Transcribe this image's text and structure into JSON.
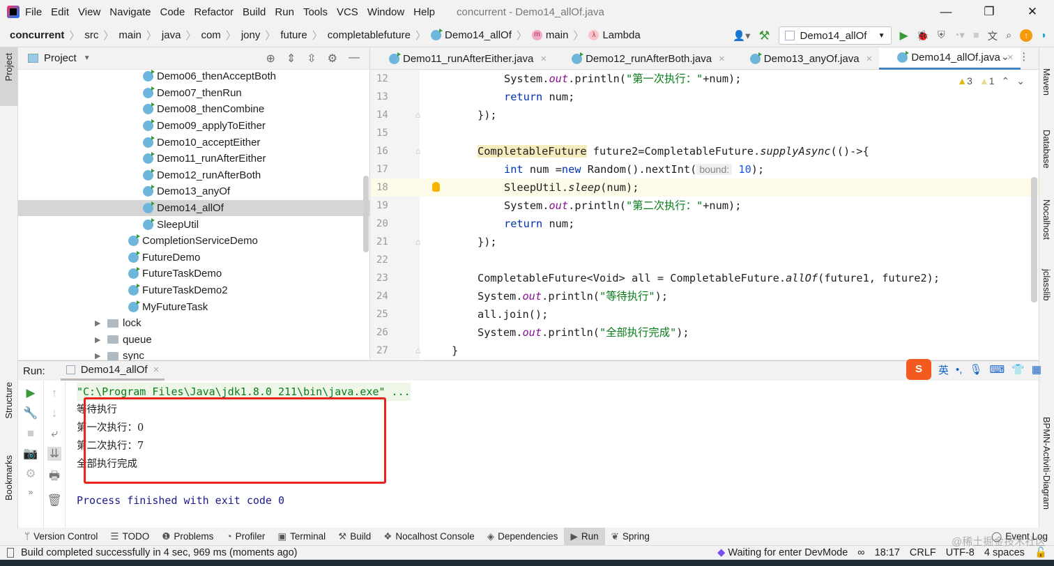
{
  "menu": [
    "File",
    "Edit",
    "View",
    "Navigate",
    "Code",
    "Refactor",
    "Build",
    "Run",
    "Tools",
    "VCS",
    "Window",
    "Help"
  ],
  "window_title": "concurrent - Demo14_allOf.java",
  "breadcrumbs": [
    "concurrent",
    "src",
    "main",
    "java",
    "com",
    "jony",
    "future",
    "completablefuture",
    "Demo14_allOf",
    "main",
    "Lambda"
  ],
  "run_config": "Demo14_allOf",
  "project_panel": {
    "title": "Project",
    "items": [
      {
        "label": "Demo06_thenAcceptBoth",
        "type": "class",
        "depth": 3
      },
      {
        "label": "Demo07_thenRun",
        "type": "class",
        "depth": 3
      },
      {
        "label": "Demo08_thenCombine",
        "type": "class",
        "depth": 3
      },
      {
        "label": "Demo09_applyToEither",
        "type": "class",
        "depth": 3
      },
      {
        "label": "Demo10_acceptEither",
        "type": "class",
        "depth": 3
      },
      {
        "label": "Demo11_runAfterEither",
        "type": "class",
        "depth": 3
      },
      {
        "label": "Demo12_runAfterBoth",
        "type": "class",
        "depth": 3
      },
      {
        "label": "Demo13_anyOf",
        "type": "class",
        "depth": 3
      },
      {
        "label": "Demo14_allOf",
        "type": "class",
        "depth": 3,
        "selected": true
      },
      {
        "label": "SleepUtil",
        "type": "class",
        "depth": 3
      },
      {
        "label": "CompletionServiceDemo",
        "type": "class",
        "depth": 2
      },
      {
        "label": "FutureDemo",
        "type": "class",
        "depth": 2
      },
      {
        "label": "FutureTaskDemo",
        "type": "class",
        "depth": 2
      },
      {
        "label": "FutureTaskDemo2",
        "type": "class",
        "depth": 2
      },
      {
        "label": "MyFutureTask",
        "type": "class",
        "depth": 2
      },
      {
        "label": "lock",
        "type": "folder",
        "depth": 1
      },
      {
        "label": "queue",
        "type": "folder",
        "depth": 1
      },
      {
        "label": "sync",
        "type": "folder",
        "depth": 1
      }
    ]
  },
  "editor_tabs": [
    {
      "label": "Demo11_runAfterEither.java"
    },
    {
      "label": "Demo12_runAfterBoth.java"
    },
    {
      "label": "Demo13_anyOf.java"
    },
    {
      "label": "Demo14_allOf.java",
      "active": true
    }
  ],
  "inspections": {
    "warnings": "3",
    "weak_warnings": "1"
  },
  "code": [
    {
      "n": "12",
      "indent": 2,
      "seg": [
        [
          "System.",
          ""
        ],
        [
          "out",
          "f"
        ],
        [
          ".println(",
          ""
        ],
        [
          "\"第一次执行：\"",
          "s"
        ],
        [
          "+num);",
          ""
        ]
      ]
    },
    {
      "n": "13",
      "indent": 2,
      "seg": [
        [
          "return",
          "k"
        ],
        [
          " num;",
          ""
        ]
      ]
    },
    {
      "n": "14",
      "indent": 1,
      "seg": [
        [
          "});",
          ""
        ]
      ]
    },
    {
      "n": "15",
      "indent": 0,
      "seg": []
    },
    {
      "n": "16",
      "indent": 1,
      "seg": [
        [
          "CompletableFuture",
          "hl"
        ],
        [
          " future2=CompletableFuture.",
          ""
        ],
        [
          "supplyAsync",
          "i"
        ],
        [
          "(()->{",
          ""
        ]
      ]
    },
    {
      "n": "17",
      "indent": 2,
      "seg": [
        [
          "int",
          "k"
        ],
        [
          " num =",
          ""
        ],
        [
          "new",
          "k"
        ],
        [
          " Random().nextInt(",
          ""
        ],
        [
          "bound:",
          "hint"
        ],
        [
          " ",
          ""
        ],
        [
          "10",
          "n"
        ],
        [
          ");",
          ""
        ]
      ]
    },
    {
      "n": "18",
      "indent": 2,
      "current": true,
      "seg": [
        [
          "SleepUtil",
          ""
        ],
        [
          ".",
          ""
        ],
        [
          "sleep",
          "i"
        ],
        [
          "(num);",
          ""
        ]
      ]
    },
    {
      "n": "19",
      "indent": 2,
      "seg": [
        [
          "System.",
          ""
        ],
        [
          "out",
          "f"
        ],
        [
          ".println(",
          ""
        ],
        [
          "\"第二次执行：\"",
          "s"
        ],
        [
          "+num);",
          ""
        ]
      ]
    },
    {
      "n": "20",
      "indent": 2,
      "seg": [
        [
          "return",
          "k"
        ],
        [
          " num;",
          ""
        ]
      ]
    },
    {
      "n": "21",
      "indent": 1,
      "seg": [
        [
          "});",
          ""
        ]
      ]
    },
    {
      "n": "22",
      "indent": 0,
      "seg": []
    },
    {
      "n": "23",
      "indent": 1,
      "seg": [
        [
          "CompletableFuture<Void> all = CompletableFuture.",
          ""
        ],
        [
          "allOf",
          "i"
        ],
        [
          "(future1, future2);",
          ""
        ]
      ]
    },
    {
      "n": "24",
      "indent": 1,
      "seg": [
        [
          "System.",
          ""
        ],
        [
          "out",
          "f"
        ],
        [
          ".println(",
          ""
        ],
        [
          "\"等待执行\"",
          "s"
        ],
        [
          ");",
          ""
        ]
      ]
    },
    {
      "n": "25",
      "indent": 1,
      "seg": [
        [
          "all.join();",
          ""
        ]
      ]
    },
    {
      "n": "26",
      "indent": 1,
      "seg": [
        [
          "System.",
          ""
        ],
        [
          "out",
          "f"
        ],
        [
          ".println(",
          ""
        ],
        [
          "\"全部执行完成\"",
          "s"
        ],
        [
          ");",
          ""
        ]
      ]
    },
    {
      "n": "27",
      "indent": 0,
      "seg": [
        [
          "}",
          ""
        ]
      ]
    }
  ],
  "run_panel": {
    "label": "Run:",
    "tab": "Demo14_allOf",
    "command": "\"C:\\Program Files\\Java\\jdk1.8.0_211\\bin\\java.exe\" ...",
    "output": [
      "等待执行",
      "第一次执行：0",
      "第二次执行：7",
      "全部执行完成"
    ],
    "exit": "Process finished with exit code 0"
  },
  "ime": {
    "lang": "英",
    "logo": "S"
  },
  "left_stripe": [
    "Project",
    "Structure",
    "Bookmarks"
  ],
  "right_stripe": [
    "Maven",
    "Database",
    "Nocalhost",
    "jclasslib",
    "BPMN-Activiti-Diagram"
  ],
  "tool_windows": [
    "Version Control",
    "TODO",
    "Problems",
    "Profiler",
    "Terminal",
    "Build",
    "Nocalhost Console",
    "Dependencies",
    "Run",
    "Spring",
    "Event Log"
  ],
  "status": {
    "message": "Build completed successfully in 4 sec, 969 ms (moments ago)",
    "devmode": "Waiting for enter DevMode",
    "position": "18:17",
    "line_sep": "CRLF",
    "encoding": "UTF-8",
    "indent": "4 spaces"
  },
  "watermark": "@稀土掘金技术社区"
}
